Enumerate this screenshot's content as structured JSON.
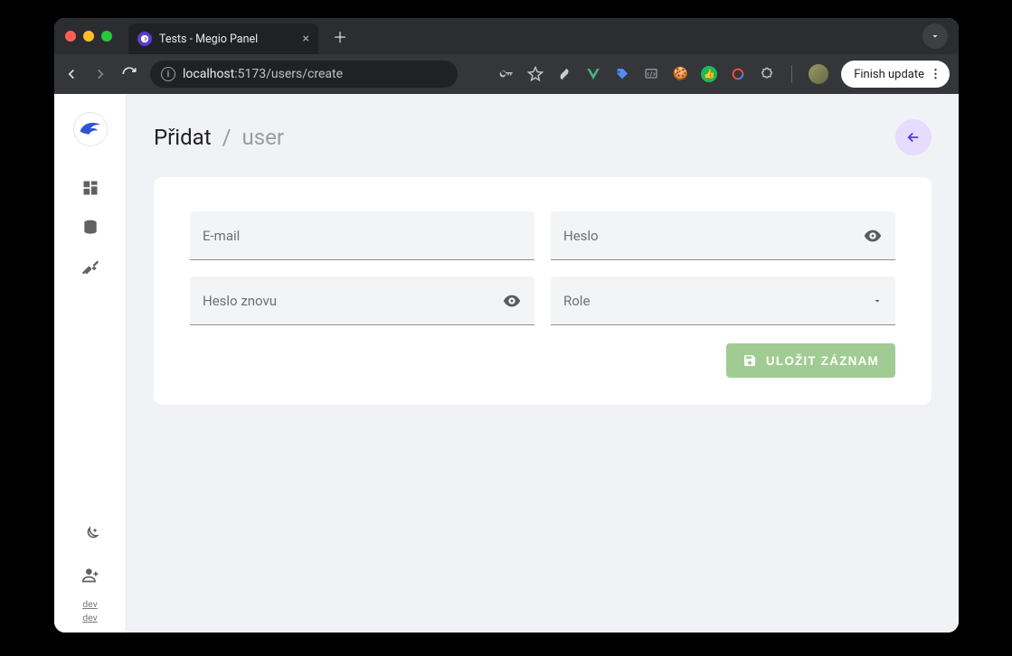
{
  "browser": {
    "tab_title": "Tests - Megio Panel",
    "url_host": "localhost",
    "url_port": ":5173",
    "url_path": "/users/create",
    "finish_update": "Finish update"
  },
  "sidebar": {
    "footer_labels": [
      "dev",
      "dev"
    ]
  },
  "page": {
    "breadcrumb_action": "Přidat",
    "breadcrumb_entity": "user"
  },
  "form": {
    "email_label": "E-mail",
    "password_label": "Heslo",
    "password_again_label": "Heslo znovu",
    "role_label": "Role",
    "save_label": "Uložit záznam"
  }
}
